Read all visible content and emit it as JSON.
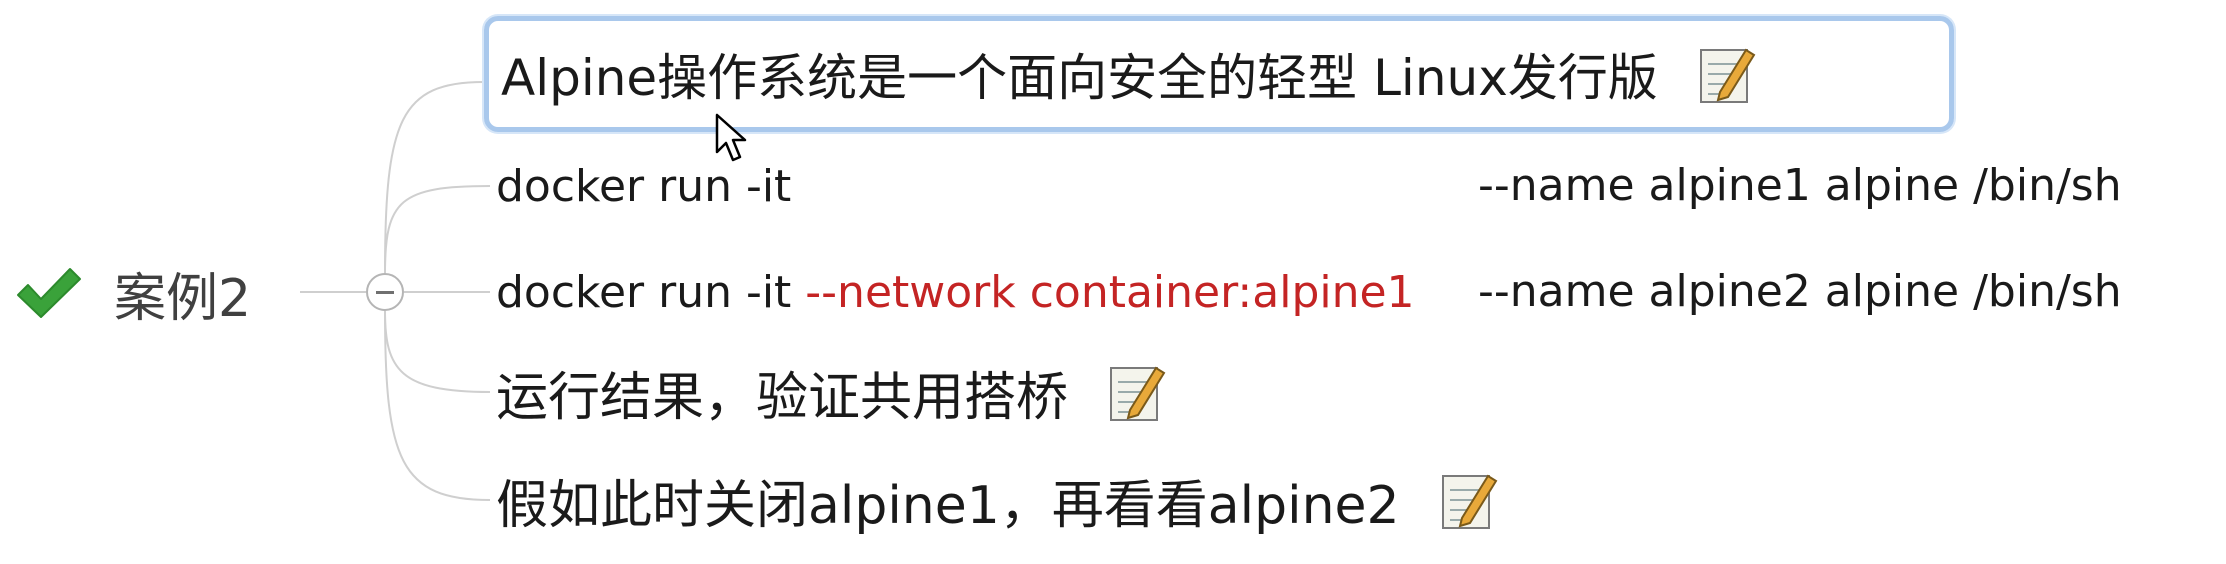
{
  "map": {
    "root": {
      "label": "案例2",
      "status_icon": "checkmark-icon"
    },
    "topics": [
      {
        "text": "Alpine操作系统是一个面向安全的轻型 Linux发行版",
        "has_note": true,
        "selected": true
      },
      {
        "prefix": "docker run -it",
        "suffix": "--name alpine1  alpine /bin/sh"
      },
      {
        "prefix": "docker run -it ",
        "highlight": "--network container:alpine1",
        "suffix": "--name alpine2  alpine /bin/sh"
      },
      {
        "text": "运行结果，验证共用搭桥",
        "has_note": true
      },
      {
        "text": "假如此时关闭alpine1，再看看alpine2",
        "has_note": true
      }
    ]
  },
  "colors": {
    "highlight_text": "#c42424",
    "selection_border": "#a9c8ec",
    "check": "#3aa23a",
    "connector": "#cfcfcf"
  }
}
